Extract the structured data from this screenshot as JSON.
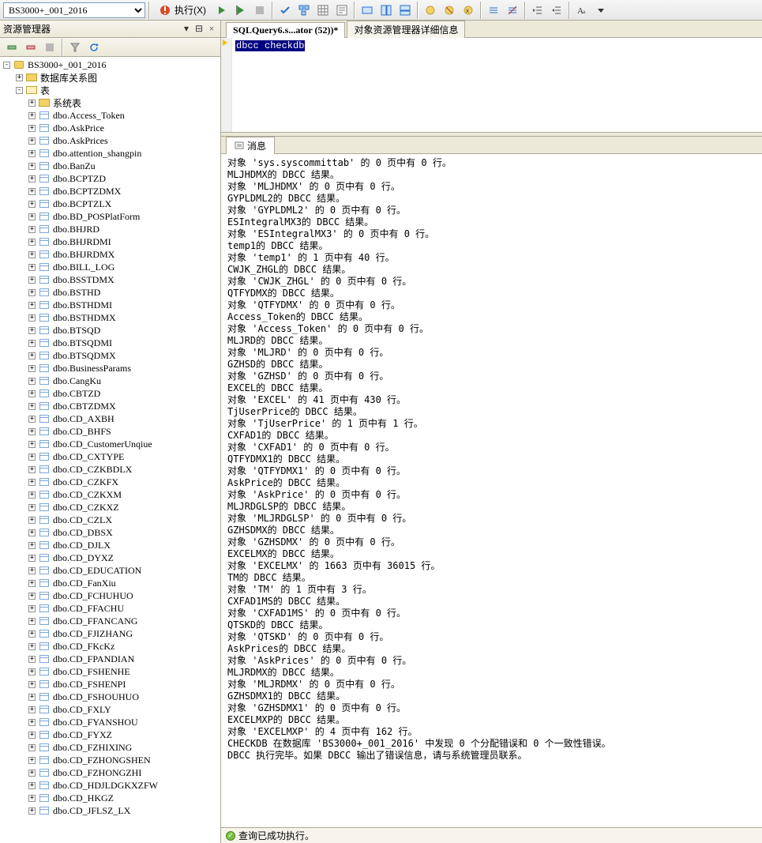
{
  "toolbar": {
    "db_selector": "BS3000+_001_2016",
    "execute_label": "执行(X)"
  },
  "explorer": {
    "title": "资源管理器",
    "root": "BS3000+_001_2016",
    "folders": {
      "diagrams": "数据库关系图",
      "tables": "表",
      "systables": "系统表"
    },
    "tables": [
      "dbo.Access_Token",
      "dbo.AskPrice",
      "dbo.AskPrices",
      "dbo.attention_shangpin",
      "dbo.BanZu",
      "dbo.BCPTZD",
      "dbo.BCPTZDMX",
      "dbo.BCPTZLX",
      "dbo.BD_POSPlatForm",
      "dbo.BHJRD",
      "dbo.BHJRDMI",
      "dbo.BHJRDMX",
      "dbo.BILL_LOG",
      "dbo.BSSTDMX",
      "dbo.BSTHD",
      "dbo.BSTHDMI",
      "dbo.BSTHDMX",
      "dbo.BTSQD",
      "dbo.BTSQDMI",
      "dbo.BTSQDMX",
      "dbo.BusinessParams",
      "dbo.CangKu",
      "dbo.CBTZD",
      "dbo.CBTZDMX",
      "dbo.CD_AXBH",
      "dbo.CD_BHFS",
      "dbo.CD_CustomerUnqiue",
      "dbo.CD_CXTYPE",
      "dbo.CD_CZKBDLX",
      "dbo.CD_CZKFX",
      "dbo.CD_CZKXM",
      "dbo.CD_CZKXZ",
      "dbo.CD_CZLX",
      "dbo.CD_DBSX",
      "dbo.CD_DJLX",
      "dbo.CD_DYXZ",
      "dbo.CD_EDUCATION",
      "dbo.CD_FanXiu",
      "dbo.CD_FCHUHUO",
      "dbo.CD_FFACHU",
      "dbo.CD_FFANCANG",
      "dbo.CD_FJIZHANG",
      "dbo.CD_FKcKz",
      "dbo.CD_FPANDIAN",
      "dbo.CD_FSHENHE",
      "dbo.CD_FSHENPI",
      "dbo.CD_FSHOUHUO",
      "dbo.CD_FXLY",
      "dbo.CD_FYANSHOU",
      "dbo.CD_FYXZ",
      "dbo.CD_FZHIXING",
      "dbo.CD_FZHONGSHEN",
      "dbo.CD_FZHONGZHI",
      "dbo.CD_HDJLDGKXZFW",
      "dbo.CD_HKGZ",
      "dbo.CD_JFLSZ_LX"
    ]
  },
  "tabs": {
    "active": "SQLQuery6.s...ator (52))*",
    "other": "对象资源管理器详细信息"
  },
  "code": {
    "line1": "dbcc checkdb"
  },
  "results": {
    "tab_label": "消息",
    "lines": [
      "对象 'sys.syscommittab' 的 0 页中有 0 行。",
      "MLJHDMX的 DBCC 结果。",
      "对象 'MLJHDMX' 的 0 页中有 0 行。",
      "GYPLDML2的 DBCC 结果。",
      "对象 'GYPLDML2' 的 0 页中有 0 行。",
      "ESIntegralMX3的 DBCC 结果。",
      "对象 'ESIntegralMX3' 的 0 页中有 0 行。",
      "temp1的 DBCC 结果。",
      "对象 'temp1' 的 1 页中有 40 行。",
      "CWJK_ZHGL的 DBCC 结果。",
      "对象 'CWJK_ZHGL' 的 0 页中有 0 行。",
      "QTFYDMX的 DBCC 结果。",
      "对象 'QTFYDMX' 的 0 页中有 0 行。",
      "Access_Token的 DBCC 结果。",
      "对象 'Access_Token' 的 0 页中有 0 行。",
      "MLJRD的 DBCC 结果。",
      "对象 'MLJRD' 的 0 页中有 0 行。",
      "GZHSD的 DBCC 结果。",
      "对象 'GZHSD' 的 0 页中有 0 行。",
      "EXCEL的 DBCC 结果。",
      "对象 'EXCEL' 的 41 页中有 430 行。",
      "TjUserPrice的 DBCC 结果。",
      "对象 'TjUserPrice' 的 1 页中有 1 行。",
      "CXFAD1的 DBCC 结果。",
      "对象 'CXFAD1' 的 0 页中有 0 行。",
      "QTFYDMX1的 DBCC 结果。",
      "对象 'QTFYDMX1' 的 0 页中有 0 行。",
      "AskPrice的 DBCC 结果。",
      "对象 'AskPrice' 的 0 页中有 0 行。",
      "MLJRDGLSP的 DBCC 结果。",
      "对象 'MLJRDGLSP' 的 0 页中有 0 行。",
      "GZHSDMX的 DBCC 结果。",
      "对象 'GZHSDMX' 的 0 页中有 0 行。",
      "EXCELMX的 DBCC 结果。",
      "对象 'EXCELMX' 的 1663 页中有 36015 行。",
      "TM的 DBCC 结果。",
      "对象 'TM' 的 1 页中有 3 行。",
      "CXFAD1MS的 DBCC 结果。",
      "对象 'CXFAD1MS' 的 0 页中有 0 行。",
      "QTSKD的 DBCC 结果。",
      "对象 'QTSKD' 的 0 页中有 0 行。",
      "AskPrices的 DBCC 结果。",
      "对象 'AskPrices' 的 0 页中有 0 行。",
      "MLJRDMX的 DBCC 结果。",
      "对象 'MLJRDMX' 的 0 页中有 0 行。",
      "GZHSDMX1的 DBCC 结果。",
      "对象 'GZHSDMX1' 的 0 页中有 0 行。",
      "EXCELMXP的 DBCC 结果。",
      "对象 'EXCELMXP' 的 4 页中有 162 行。",
      "CHECKDB 在数据库 'BS3000+_001_2016' 中发现 0 个分配错误和 0 个一致性错误。",
      "DBCC 执行完毕。如果 DBCC 输出了错误信息，请与系统管理员联系。"
    ]
  },
  "status": {
    "text": "查询已成功执行。"
  }
}
